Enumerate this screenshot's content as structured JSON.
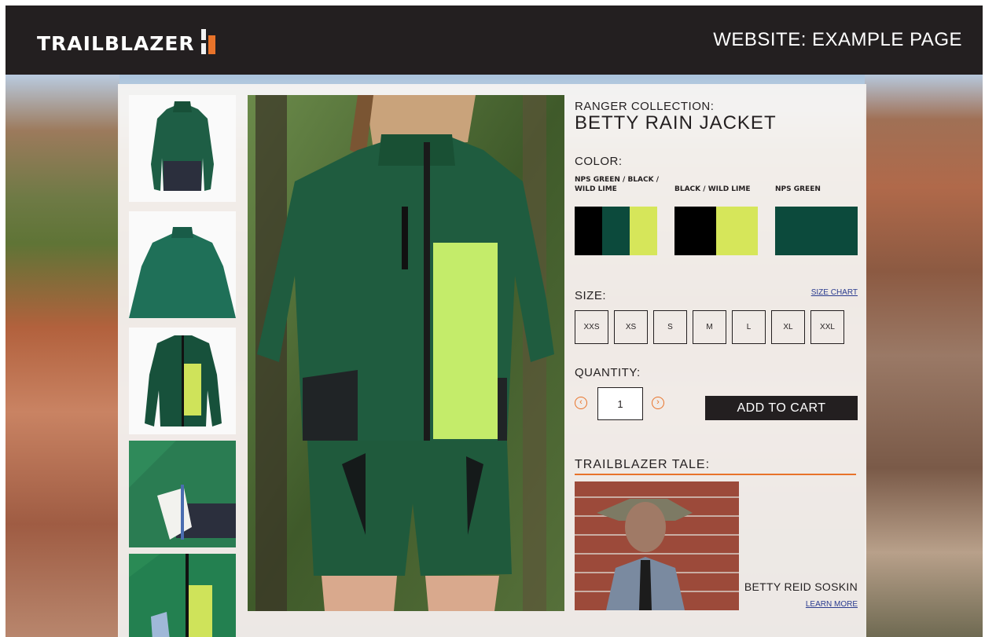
{
  "header": {
    "logo_text": "TRAILBLAZER",
    "title": "WEBSITE: EXAMPLE PAGE"
  },
  "brand_colors": {
    "dark": "#231f20",
    "accent_orange": "#e8732a",
    "nps_green": "#0c4a3c",
    "wild_lime": "#d6e65a",
    "black": "#000000"
  },
  "product": {
    "collection": "RANGER COLLECTION:",
    "name": "BETTY RAIN JACKET"
  },
  "color": {
    "label": "COLOR:",
    "options": [
      {
        "label": "NPS GREEN / BLACK / WILD LIME",
        "colors": [
          "#000000",
          "#0c4a3c",
          "#d6e65a"
        ]
      },
      {
        "label": "BLACK / WILD LIME",
        "colors": [
          "#000000",
          "#d6e65a"
        ]
      },
      {
        "label": "NPS GREEN",
        "colors": [
          "#0c4a3c"
        ]
      }
    ]
  },
  "size": {
    "label": "SIZE:",
    "chart_link": "SIZE CHART",
    "options": [
      "XXS",
      "XS",
      "S",
      "M",
      "L",
      "XL",
      "XXL"
    ]
  },
  "quantity": {
    "label": "QUANTITY:",
    "value": "1",
    "decrease_icon": "chevron-left-circle-icon",
    "increase_icon": "chevron-right-circle-icon"
  },
  "cart": {
    "button_label": "ADD TO CART"
  },
  "tale": {
    "title": "TRAILBLAZER TALE:",
    "person_name": "BETTY REID SOSKIN",
    "learn_more": "LEARN MORE"
  },
  "thumbnails": [
    "jacket-back-green-black",
    "jacket-back-green",
    "jacket-front-green-lime",
    "jacket-pocket-detail",
    "jacket-front-lime-detail"
  ]
}
